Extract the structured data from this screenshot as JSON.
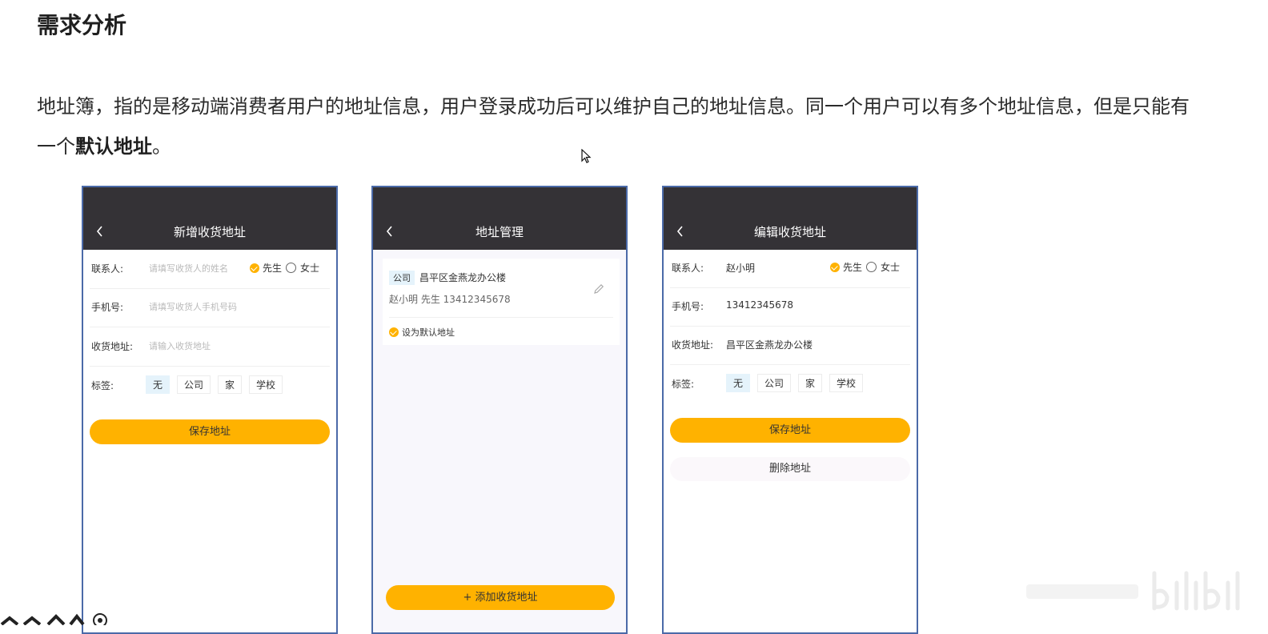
{
  "section_title": "需求分析",
  "paragraph": {
    "text1": "地址簿，指的是移动端消费者用户的地址信息，用户登录成功后可以维护自己的地址信息。同一个用户可以有多个地址信息，但是只能有一个",
    "bold": "默认地址",
    "text2": "。"
  },
  "screens": {
    "add": {
      "title": "新增收货地址",
      "contact_label": "联系人:",
      "contact_placeholder": "请填写收货人的姓名",
      "gender_male": "先生",
      "gender_female": "女士",
      "phone_label": "手机号:",
      "phone_placeholder": "请填写收货人手机号码",
      "address_label": "收货地址:",
      "address_placeholder": "请输入收货地址",
      "tag_label": "标签:",
      "tags": [
        "无",
        "公司",
        "家",
        "学校"
      ],
      "save_button": "保存地址"
    },
    "manage": {
      "title": "地址管理",
      "card_tag": "公司",
      "card_address": "昌平区金燕龙办公楼",
      "card_contact": "赵小明 先生   13412345678",
      "default_label": "设为默认地址",
      "add_button": "+ 添加收货地址"
    },
    "edit": {
      "title": "编辑收货地址",
      "contact_label": "联系人:",
      "contact_value": "赵小明",
      "gender_male": "先生",
      "gender_female": "女士",
      "phone_label": "手机号:",
      "phone_value": "13412345678",
      "address_label": "收货地址:",
      "address_value": "昌平区金燕龙办公楼",
      "tag_label": "标签:",
      "tags": [
        "无",
        "公司",
        "家",
        "学校"
      ],
      "save_button": "保存地址",
      "delete_button": "删除地址"
    }
  },
  "colors": {
    "accent": "#ffb200",
    "navbar": "#343236",
    "tag_active": "#e5f3fb"
  }
}
